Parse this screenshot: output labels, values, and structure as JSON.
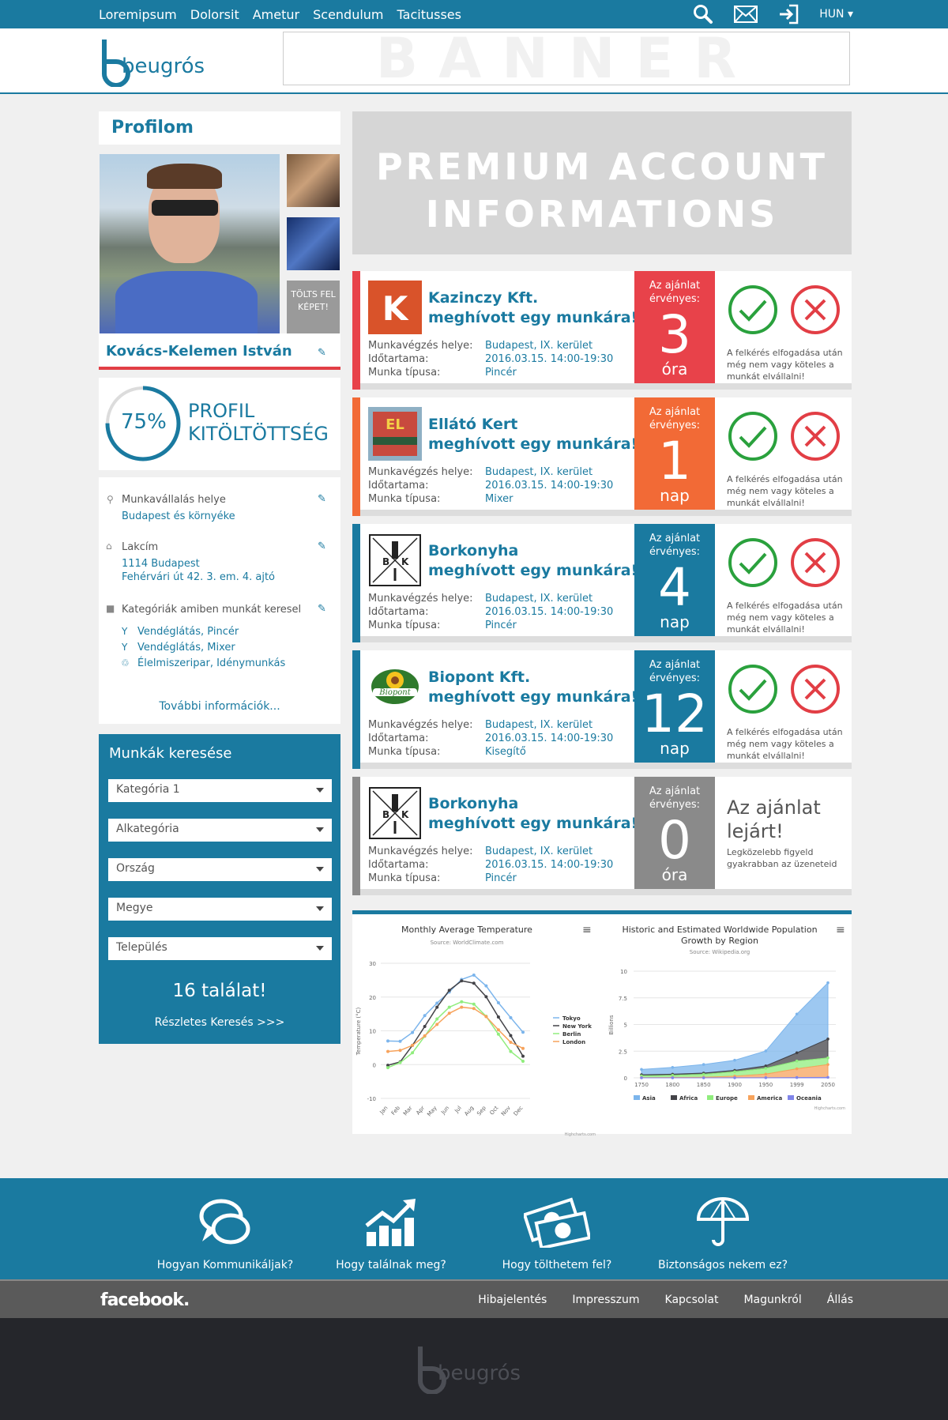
{
  "topnav": {
    "items": [
      "Loremipsum",
      "Dolorsit",
      "Ametur",
      "Scendulum",
      "Tacitusses"
    ],
    "lang": "HUN"
  },
  "brand": {
    "logo_text": "beugrós",
    "banner_text": "BANNER"
  },
  "profile": {
    "title": "Profilom",
    "name": "Kovács-Kelemen István",
    "upload_label": "TÖLTS FEL KÉPET!",
    "completion_value": 75,
    "completion_text": "75%",
    "completion_label": "PROFIL KITÖLTÖTTSÉG",
    "work_place_label": "Munkavállalás helye",
    "work_place_value": "Budapest és környéke",
    "address_label": "Lakcím",
    "address_line1": "1114 Budapest",
    "address_line2": "Fehérvári út 42. 3. em. 4. ajtó",
    "categories_label": "Kategóriák amiben munkát keresel",
    "categories": [
      "Vendéglátás, Pincér",
      "Vendéglátás, Mixer",
      "Élelmiszeripar, Idénymunkás"
    ],
    "more_info": "További információk..."
  },
  "search": {
    "title": "Munkák keresése",
    "selects": [
      "Kategória 1",
      "Alkategória",
      "Ország",
      "Megye",
      "Település"
    ],
    "results": "16 találat!",
    "detailed": "Részletes Keresés >>>"
  },
  "premium": {
    "line1": "PREMIUM ACCOUNT",
    "line2": "INFORMATIONS"
  },
  "labels": {
    "place": "Munkavégzés helye:",
    "duration": "Időtartama:",
    "type": "Munka típusa:",
    "valid1": "Az ajánlat",
    "valid2": "érvényes:",
    "note1": "A felkérés elfogadása után",
    "note2": "még nem vagy köteles a",
    "note3": "munkát elvállalni!",
    "expired1": "Az ajánlat",
    "expired2": "lejárt!",
    "expired_sub1": "Legközelebb figyeld",
    "expired_sub2": "gyakrabban az üzeneteid"
  },
  "offers": [
    {
      "company": "Kazinczy Kft.",
      "subtitle": "meghívott egy munkára!",
      "place": "Budapest, IX. kerület",
      "duration": "2016.03.15. 14:00-19:30",
      "type": "Pincér",
      "num": "3",
      "unit": "óra",
      "color": "#e8424a",
      "logo": "K"
    },
    {
      "company": "Ellátó Kert",
      "subtitle": "meghívott egy munkára!",
      "place": "Budapest, IX. kerület",
      "duration": "2016.03.15. 14:00-19:30",
      "type": "Mixer",
      "num": "1",
      "unit": "nap",
      "color": "#f26a36",
      "logo": "EL"
    },
    {
      "company": "Borkonyha",
      "subtitle": "meghívott egy munkára!",
      "place": "Budapest, IX. kerület",
      "duration": "2016.03.15. 14:00-19:30",
      "type": "Pincér",
      "num": "4",
      "unit": "nap",
      "color": "#1a7aa0",
      "logo": "BK"
    },
    {
      "company": "Biopont Kft.",
      "subtitle": "meghívott egy munkára!",
      "place": "Budapest, IX. kerület",
      "duration": "2016.03.15. 14:00-19:30",
      "type": "Kisegítő",
      "num": "12",
      "unit": "nap",
      "color": "#1a7aa0",
      "logo": "Biopont"
    },
    {
      "company": "Borkonyha",
      "subtitle": "meghívott egy munkára!",
      "place": "Budapest, IX. kerület",
      "duration": "2016.03.15. 14:00-19:30",
      "type": "Pincér",
      "num": "0",
      "unit": "óra",
      "color": "#8a8a8a",
      "logo": "BK"
    }
  ],
  "chart_data": [
    {
      "type": "line",
      "title": "Monthly Average Temperature",
      "subtitle": "Source: WorldClimate.com",
      "ylabel": "Temperature (°C)",
      "categories": [
        "Jan",
        "Feb",
        "Mar",
        "Apr",
        "May",
        "Jun",
        "Jul",
        "Aug",
        "Sep",
        "Oct",
        "Nov",
        "Dec"
      ],
      "ylim": [
        -10,
        30
      ],
      "yticks": [
        "-10",
        "0",
        "10",
        "20",
        "30"
      ],
      "legend": "right",
      "credits": "Highcharts.com",
      "series": [
        {
          "name": "Tokyo",
          "color": "#7cb5ec",
          "values": [
            7.0,
            6.9,
            9.5,
            14.5,
            18.2,
            21.5,
            25.2,
            26.5,
            23.3,
            18.3,
            13.9,
            9.6
          ]
        },
        {
          "name": "New York",
          "color": "#434348",
          "values": [
            -0.2,
            0.8,
            5.7,
            11.3,
            17.0,
            22.0,
            24.8,
            24.1,
            20.1,
            14.1,
            8.6,
            2.5
          ]
        },
        {
          "name": "Berlin",
          "color": "#90ed7d",
          "values": [
            -0.9,
            0.6,
            3.5,
            8.4,
            13.5,
            17.0,
            18.6,
            17.9,
            14.3,
            9.0,
            3.9,
            1.0
          ]
        },
        {
          "name": "London",
          "color": "#f7a35c",
          "values": [
            3.9,
            4.2,
            5.7,
            8.5,
            11.9,
            15.2,
            17.0,
            16.6,
            14.2,
            10.3,
            6.6,
            4.8
          ]
        }
      ]
    },
    {
      "type": "area",
      "title": "Historic and Estimated Worldwide Population Growth by Region",
      "subtitle": "Source: Wikipedia.org",
      "ylabel": "Billions",
      "categories": [
        "1750",
        "1800",
        "1850",
        "1900",
        "1950",
        "1999",
        "2050"
      ],
      "ylim": [
        0,
        10
      ],
      "yticks": [
        "0",
        "2.5",
        "5",
        "7.5",
        "10"
      ],
      "legend": "bottom",
      "credits": "Highcharts.com",
      "stacked": true,
      "series": [
        {
          "name": "Asia",
          "color": "#7cb5ec",
          "values": [
            502,
            635,
            809,
            947,
            1402,
            3634,
            5268
          ]
        },
        {
          "name": "Africa",
          "color": "#434348",
          "values": [
            106,
            107,
            111,
            133,
            221,
            767,
            1766
          ]
        },
        {
          "name": "Europe",
          "color": "#90ed7d",
          "values": [
            163,
            203,
            276,
            408,
            547,
            729,
            628
          ]
        },
        {
          "name": "America",
          "color": "#f7a35c",
          "values": [
            18,
            31,
            54,
            156,
            339,
            818,
            1201
          ]
        },
        {
          "name": "Oceania",
          "color": "#8085e9",
          "values": [
            2,
            2,
            2,
            6,
            13,
            30,
            46
          ]
        }
      ]
    }
  ],
  "footer": {
    "items": [
      "Hogyan Kommunikáljak?",
      "Hogy találnak meg?",
      "Hogy tölthetem fel?",
      "Biztonságos nekem ez?"
    ],
    "facebook": "facebook.",
    "links": [
      "Hibajelentés",
      "Impresszum",
      "Kapcsolat",
      "Magunkról",
      "Állás"
    ]
  },
  "colors": {
    "primary": "#1a7aa0",
    "red": "#e8424a",
    "orange": "#f26a36",
    "gray": "#8a8a8a",
    "accept": "#2aa13d",
    "reject": "#e23e45"
  }
}
